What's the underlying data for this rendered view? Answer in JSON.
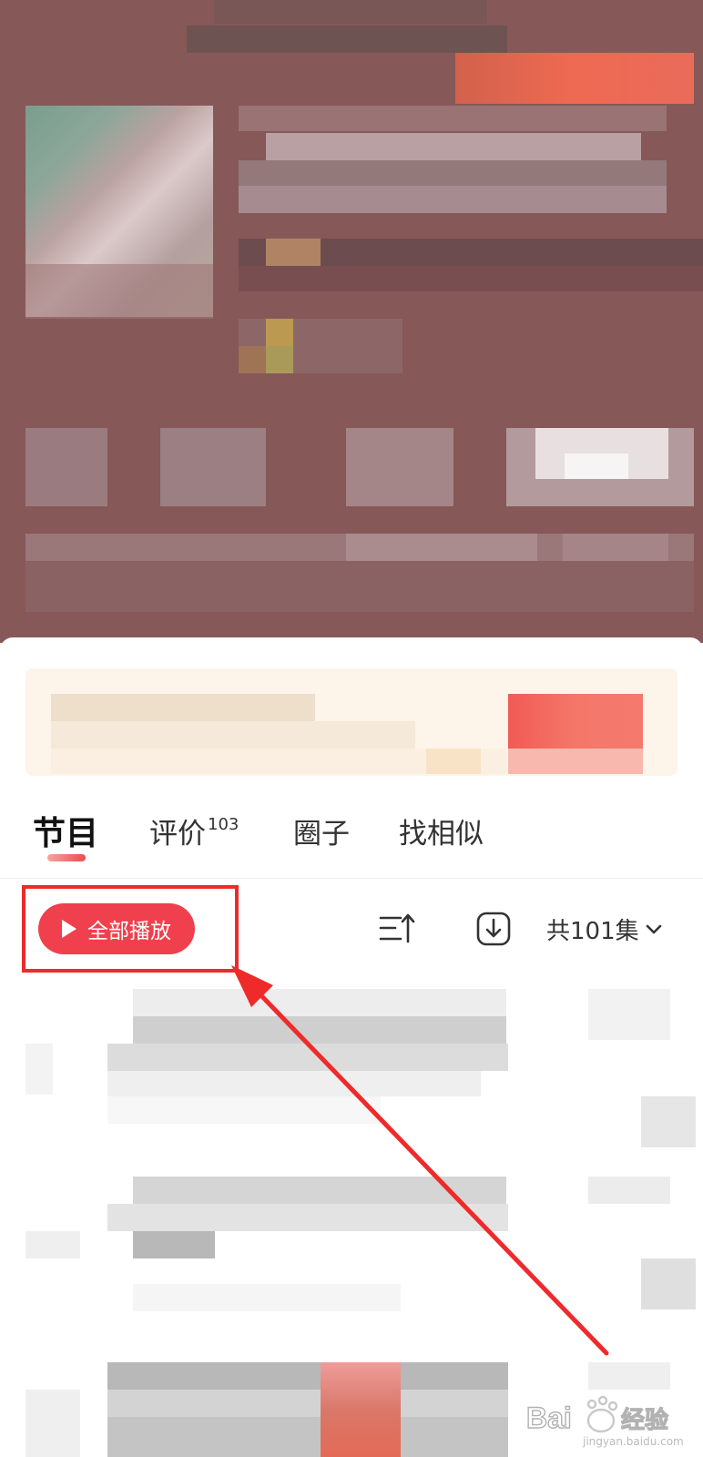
{
  "tabs": {
    "items": [
      {
        "label": "节目",
        "active": true
      },
      {
        "label": "评价",
        "badge": "103",
        "active": false
      },
      {
        "label": "圈子",
        "active": false
      },
      {
        "label": "找相似",
        "active": false
      }
    ]
  },
  "toolbar": {
    "play_all_label": "全部播放",
    "episode_count_label": "共101集"
  },
  "icons": {
    "play": "play-triangle-icon",
    "sort": "sort-icon",
    "download": "download-icon",
    "dropdown": "chevron-down-icon"
  },
  "colors": {
    "accent": "#f0404d",
    "annotation": "#ee2a2a",
    "hero_background": "#875858"
  },
  "watermark": {
    "brand": "Baidu经验",
    "url": "jingyan.baidu.com"
  }
}
